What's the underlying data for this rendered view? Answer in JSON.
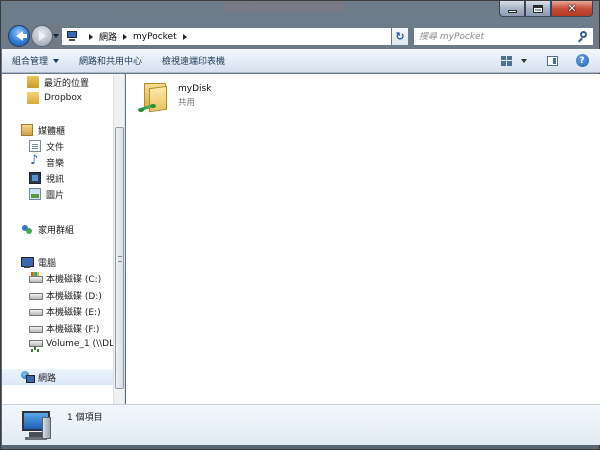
{
  "window": {
    "caption_buttons": [
      "minimize",
      "maximize",
      "close"
    ]
  },
  "navbar": {
    "breadcrumbs": [
      "網路",
      "myPocket"
    ],
    "search_placeholder": "搜尋 myPocket"
  },
  "toolbar": {
    "items": [
      "組合管理",
      "網路和共用中心",
      "檢視遠端印表機"
    ]
  },
  "sidebar": {
    "items": [
      {
        "label": "最近的位置",
        "icon": "recent-places-icon"
      },
      {
        "label": "Dropbox",
        "icon": "dropbox-icon"
      },
      {
        "label": "媒體櫃",
        "icon": "libraries-icon"
      },
      {
        "label": "文件",
        "icon": "documents-icon"
      },
      {
        "label": "音樂",
        "icon": "music-icon"
      },
      {
        "label": "視訊",
        "icon": "videos-icon"
      },
      {
        "label": "圖片",
        "icon": "pictures-icon"
      },
      {
        "label": "家用群組",
        "icon": "homegroup-icon"
      },
      {
        "label": "電腦",
        "icon": "computer-icon"
      },
      {
        "label": "本機磁碟 (C:)",
        "icon": "drive-c-icon"
      },
      {
        "label": "本機磁碟 (D:)",
        "icon": "drive-icon"
      },
      {
        "label": "本機磁碟 (E:)",
        "icon": "drive-icon"
      },
      {
        "label": "本機磁碟 (F:)",
        "icon": "drive-icon"
      },
      {
        "label": "Volume_1 (\\\\DL",
        "icon": "network-drive-icon"
      },
      {
        "label": "網路",
        "icon": "network-icon"
      }
    ]
  },
  "content": {
    "items": [
      {
        "name": "myDisk",
        "type": "共用",
        "icon": "shared-folder-icon"
      }
    ]
  },
  "details": {
    "count": "1 個項目"
  }
}
